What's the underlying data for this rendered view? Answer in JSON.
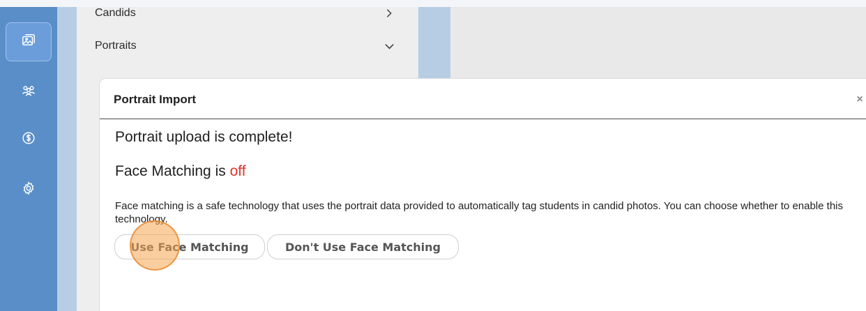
{
  "sidebar": {
    "items": [
      {
        "icon": "photos-icon",
        "active": true
      },
      {
        "icon": "people-icon",
        "active": false
      },
      {
        "icon": "dollar-icon",
        "active": false
      },
      {
        "icon": "gear-icon",
        "active": false
      }
    ]
  },
  "list": {
    "items": [
      {
        "label": "Candids",
        "chevron": "chevron-right-icon"
      },
      {
        "label": "Portraits",
        "chevron": "chevron-down-icon"
      }
    ]
  },
  "modal": {
    "title": "Portrait Import",
    "close_label": "×",
    "complete_text": "Portrait upload is complete!",
    "face_prefix": "Face Matching is ",
    "face_status": "off",
    "description": "Face matching is a safe technology that uses the portrait data provided to automatically tag students in candid photos. You can choose whether to enable this technology.",
    "use_button": "Use Face Matching",
    "dont_use_button": "Don't Use Face Matching"
  },
  "colors": {
    "rail": "#5a8ec8",
    "status_off": "#e0332b",
    "click_marker": "#f5a550"
  }
}
